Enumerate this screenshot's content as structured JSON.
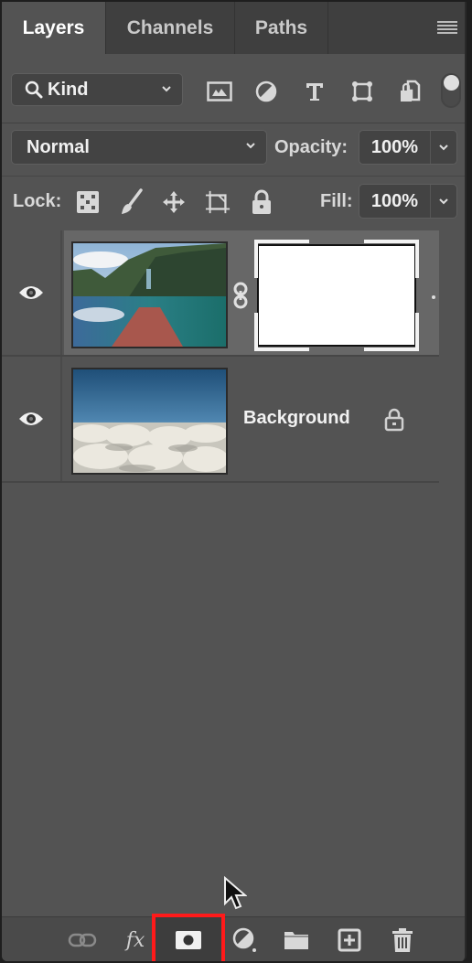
{
  "tabs": [
    {
      "label": "Layers",
      "active": true
    },
    {
      "label": "Channels",
      "active": false
    },
    {
      "label": "Paths",
      "active": false
    }
  ],
  "panel_menu_icon": "hamburger-menu-icon",
  "filter": {
    "kind_label": "Kind",
    "kind_icon": "search-icon",
    "icons": [
      "pixel-layer-filter-icon",
      "adjustment-layer-filter-icon",
      "type-layer-filter-icon",
      "shape-layer-filter-icon",
      "smart-object-filter-icon"
    ],
    "toggle_on": true
  },
  "blend": {
    "mode": "Normal",
    "opacity_label": "Opacity:",
    "opacity_value": "100%"
  },
  "lock": {
    "label": "Lock:",
    "icons": [
      "lock-transparent-pixels-icon",
      "lock-image-pixels-icon",
      "lock-position-icon",
      "lock-artboard-icon",
      "lock-all-icon"
    ],
    "fill_label": "Fill:",
    "fill_value": "100%"
  },
  "layers": [
    {
      "name": "",
      "visible": true,
      "selected": true,
      "has_mask": true,
      "thumbnail": "lake-dock-photo"
    },
    {
      "name": "Background",
      "visible": true,
      "selected": false,
      "has_mask": false,
      "locked": true,
      "thumbnail": "clouds-sky-photo"
    }
  ],
  "bottom_toolbar": [
    {
      "name": "link-layers-icon",
      "highlighted": false
    },
    {
      "name": "fx-icon",
      "label": "fx",
      "highlighted": false
    },
    {
      "name": "add-layer-mask-icon",
      "highlighted": true
    },
    {
      "name": "adjustment-layer-icon",
      "highlighted": false
    },
    {
      "name": "new-group-icon",
      "highlighted": false
    },
    {
      "name": "new-layer-icon",
      "highlighted": false
    },
    {
      "name": "delete-layer-icon",
      "highlighted": false
    }
  ],
  "colors": {
    "panel_bg": "#535353",
    "tab_bar_bg": "#3f3f3f",
    "selected_layer_bg": "#676767",
    "highlight_box": "#ff1a1a"
  }
}
